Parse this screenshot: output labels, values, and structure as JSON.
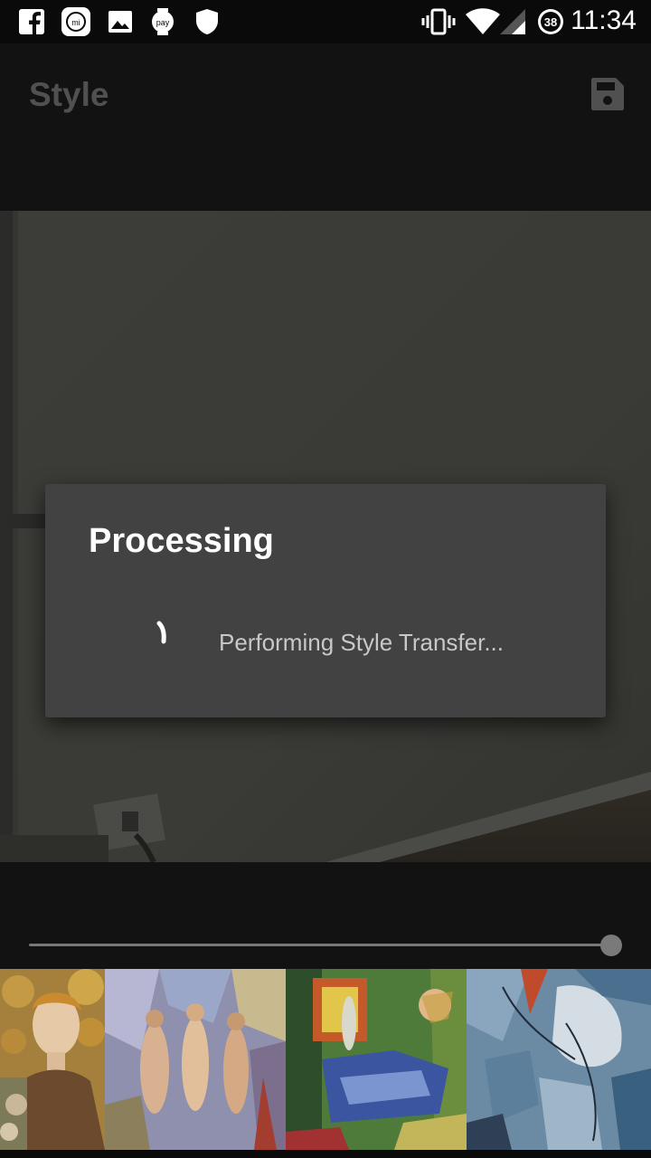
{
  "status_bar": {
    "time": "11:34",
    "battery_level": "38",
    "left_icons": [
      "facebook-icon",
      "mi-fit-icon",
      "gallery-icon",
      "pay-icon",
      "shield-icon"
    ],
    "right_icons": [
      "vibrate-icon",
      "wifi-icon",
      "signal-icon",
      "battery-icon"
    ]
  },
  "app_bar": {
    "title": "Style",
    "save_icon": "save-icon"
  },
  "dialog": {
    "title": "Processing",
    "message": "Performing Style Transfer..."
  },
  "slider": {
    "value_fraction": 1.0
  },
  "styles_strip": {
    "items": [
      {
        "name": "art-nouveau-portrait"
      },
      {
        "name": "cubist-nudes"
      },
      {
        "name": "picasso-woman-sleeping"
      },
      {
        "name": "abstract-blue"
      }
    ]
  },
  "colors": {
    "background": "#121212",
    "dialog": "#424242",
    "title_muted": "#505050"
  }
}
